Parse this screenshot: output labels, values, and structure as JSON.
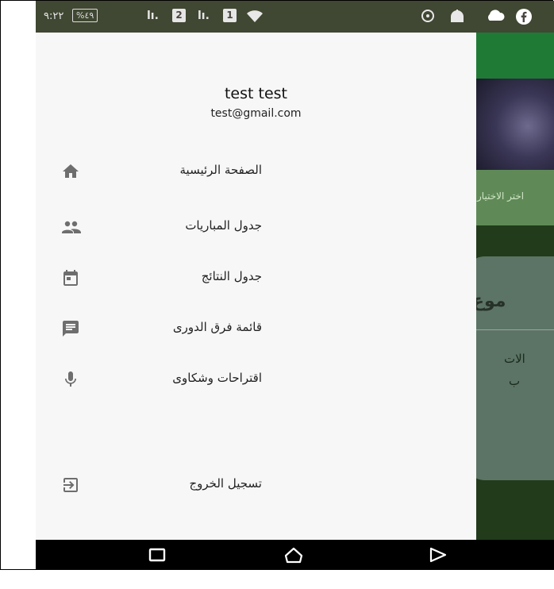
{
  "status_bar": {
    "time": "٩:٢٢",
    "battery": "%٤٩",
    "sim1_label": "2",
    "sim2_label": "1",
    "icons": [
      "wifi-icon",
      "headset-icon",
      "mosque-icon",
      "cloud-icon",
      "facebook-icon"
    ]
  },
  "background_app": {
    "chip_text": "اختر الاختيار",
    "card_title": "موع",
    "card_line1": "الات",
    "card_line2": "ب"
  },
  "drawer": {
    "user_name": "test test",
    "user_email": "test@gmail.com",
    "items": [
      {
        "label": "الصفحة الرئيسية",
        "icon": "home-icon"
      },
      {
        "label": "جدول المباريات",
        "icon": "people-icon"
      },
      {
        "label": "جدول النتائج",
        "icon": "calendar-icon"
      },
      {
        "label": "قائمة فرق الدورى",
        "icon": "chat-icon"
      },
      {
        "label": "اقتراحات وشكاوى",
        "icon": "mic-icon"
      }
    ],
    "logout": {
      "label": "تسجيل الخروج",
      "icon": "logout-icon"
    }
  },
  "nav_bar": {
    "buttons": [
      "recents-button",
      "home-button",
      "back-button"
    ]
  },
  "colors": {
    "drawer_bg": "#f7f7f7",
    "icon_gray": "#6e6e6e",
    "app_bar": "#1f7a36",
    "nav_bg": "#000000"
  }
}
